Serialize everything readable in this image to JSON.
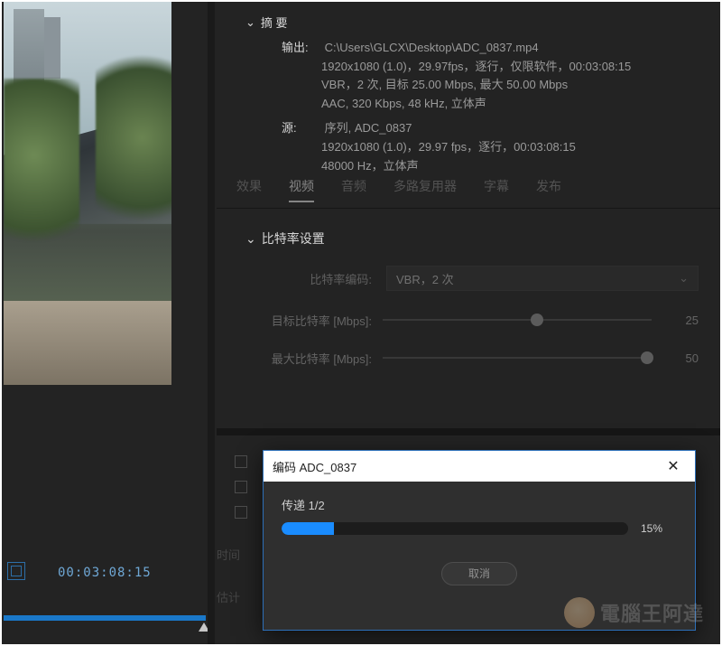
{
  "summary": {
    "title": "摘 要",
    "output_label": "输出:",
    "output_path": "C:\\Users\\GLCX\\Desktop\\ADC_0837.mp4",
    "output_line1": "1920x1080 (1.0)，29.97fps，逐行，仅限软件，00:03:08:15",
    "output_line2": "VBR，2 次, 目标 25.00 Mbps, 最大 50.00 Mbps",
    "output_line3": "AAC, 320 Kbps, 48  kHz, 立体声",
    "source_label": "源:",
    "source_line0": "序列, ADC_0837",
    "source_line1": "1920x1080 (1.0)，29.97 fps，逐行，00:03:08:15",
    "source_line2": "48000 Hz，立体声"
  },
  "tabs": {
    "t0": "效果",
    "t1": "视频",
    "t2": "音频",
    "t3": "多路复用器",
    "t4": "字幕",
    "t5": "发布",
    "active": "视频"
  },
  "bitrate": {
    "section_title": "比特率设置",
    "encoding_label": "比特率编码:",
    "encoding_value": "VBR，2 次",
    "target_label": "目标比特率 [Mbps]:",
    "target_value": "25",
    "target_thumb_pct": 55,
    "max_label": "最大比特率 [Mbps]:",
    "max_value": "50",
    "max_thumb_pct": 96
  },
  "lower": {
    "time_label": "时间",
    "est_label": "估计"
  },
  "timeline": {
    "timecode": "00:03:08:15"
  },
  "dialog": {
    "title": "编码 ADC_0837",
    "pass_label": "传递 1/2",
    "percent_text": "15%",
    "percent_value": 15,
    "cancel": "取消"
  },
  "watermark": {
    "text": "電腦王阿達"
  }
}
